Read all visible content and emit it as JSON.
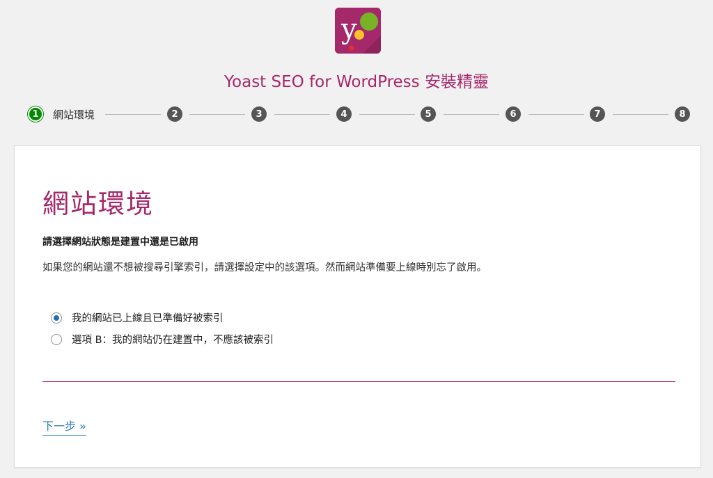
{
  "app": {
    "title": "Yoast SEO for WordPress 安裝精靈",
    "logo_icon": "yoast-logo-icon",
    "brand_color": "#a4286a"
  },
  "stepper": {
    "current_label": "網站環境",
    "steps": [
      "1",
      "2",
      "3",
      "4",
      "5",
      "6",
      "7",
      "8"
    ],
    "active_color": "#008a00",
    "inactive_color": "#555555"
  },
  "panel": {
    "heading": "網站環境",
    "question": "請選擇網站狀態是建置中還是已啟用",
    "description": "如果您的網站還不想被搜尋引擎索引，請選擇設定中的該選項。然而網站準備要上線時別忘了啟用。",
    "options": [
      {
        "label": "我的網站已上線且已準備好被索引",
        "checked": true
      },
      {
        "label": "選項 B：我的網站仍在建置中，不應該被索引",
        "checked": false
      }
    ],
    "next_label": "下一步 »"
  }
}
